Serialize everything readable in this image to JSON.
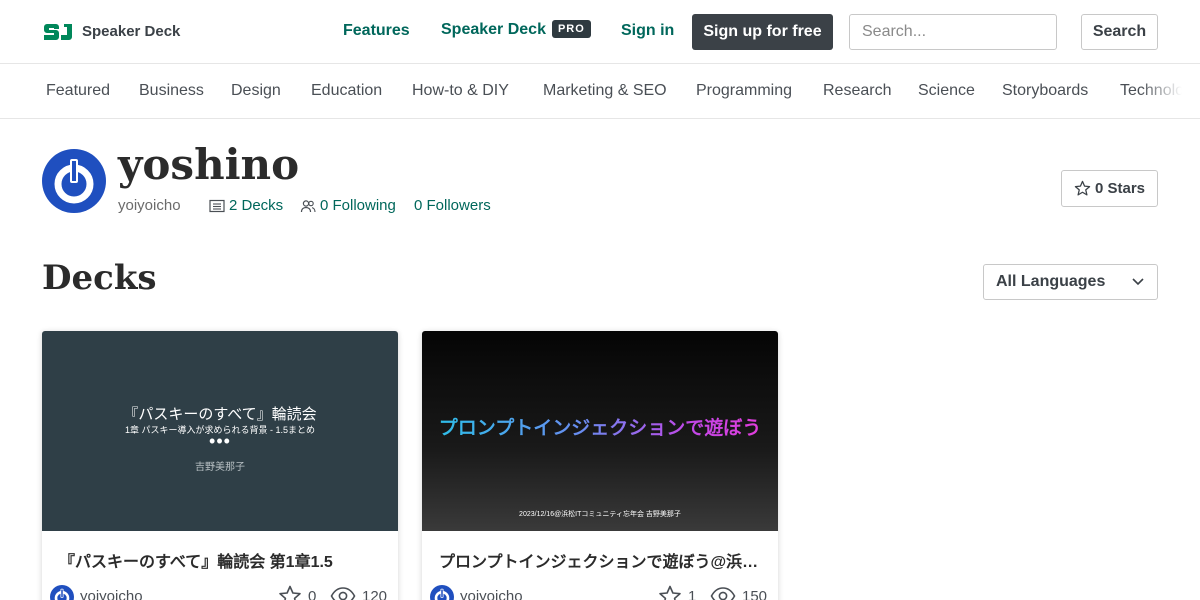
{
  "header": {
    "brand": "Speaker Deck",
    "nav_features": "Features",
    "nav_speakerdeck": "Speaker Deck",
    "pro_badge": "PRO",
    "nav_signin": "Sign in",
    "signup_label": "Sign up for free",
    "search_placeholder": "Search...",
    "search_button": "Search"
  },
  "categories": [
    "Featured",
    "Business",
    "Design",
    "Education",
    "How-to & DIY",
    "Marketing & SEO",
    "Programming",
    "Research",
    "Science",
    "Storyboards",
    "Technology"
  ],
  "profile": {
    "name": "yoshino",
    "handle": "yoiyoicho",
    "decks": "2 Decks",
    "following": "0 Following",
    "followers": "0 Followers",
    "stars_button": "0 Stars"
  },
  "decks_section": {
    "title": "Decks",
    "language_select": "All Languages"
  },
  "decks": [
    {
      "thumb_title": "『パスキーのすべて』輪読会",
      "thumb_subtitle": "1章 パスキー導入が求められる背景 - 1.5まとめ",
      "thumb_dots": "•••",
      "thumb_author": "吉野美那子",
      "title": "『パスキーのすべて』輪読会 第1章1.5",
      "author": "yoiyoicho",
      "stars": "0",
      "views": "120"
    },
    {
      "thumb_title": "プロンプトインジェクションで遊ぼう",
      "thumb_footer": "2023/12/16@浜松ITコミュニティ忘年会 吉野美那子",
      "title": "プロンプトインジェクションで遊ぼう@浜松ITコミュニティ忘年会",
      "author": "yoiyoicho",
      "stars": "1",
      "views": "150"
    }
  ],
  "colors": {
    "accent": "#00675b",
    "dark": "#3b4147",
    "avatar_blue": "#1f4fbf"
  }
}
